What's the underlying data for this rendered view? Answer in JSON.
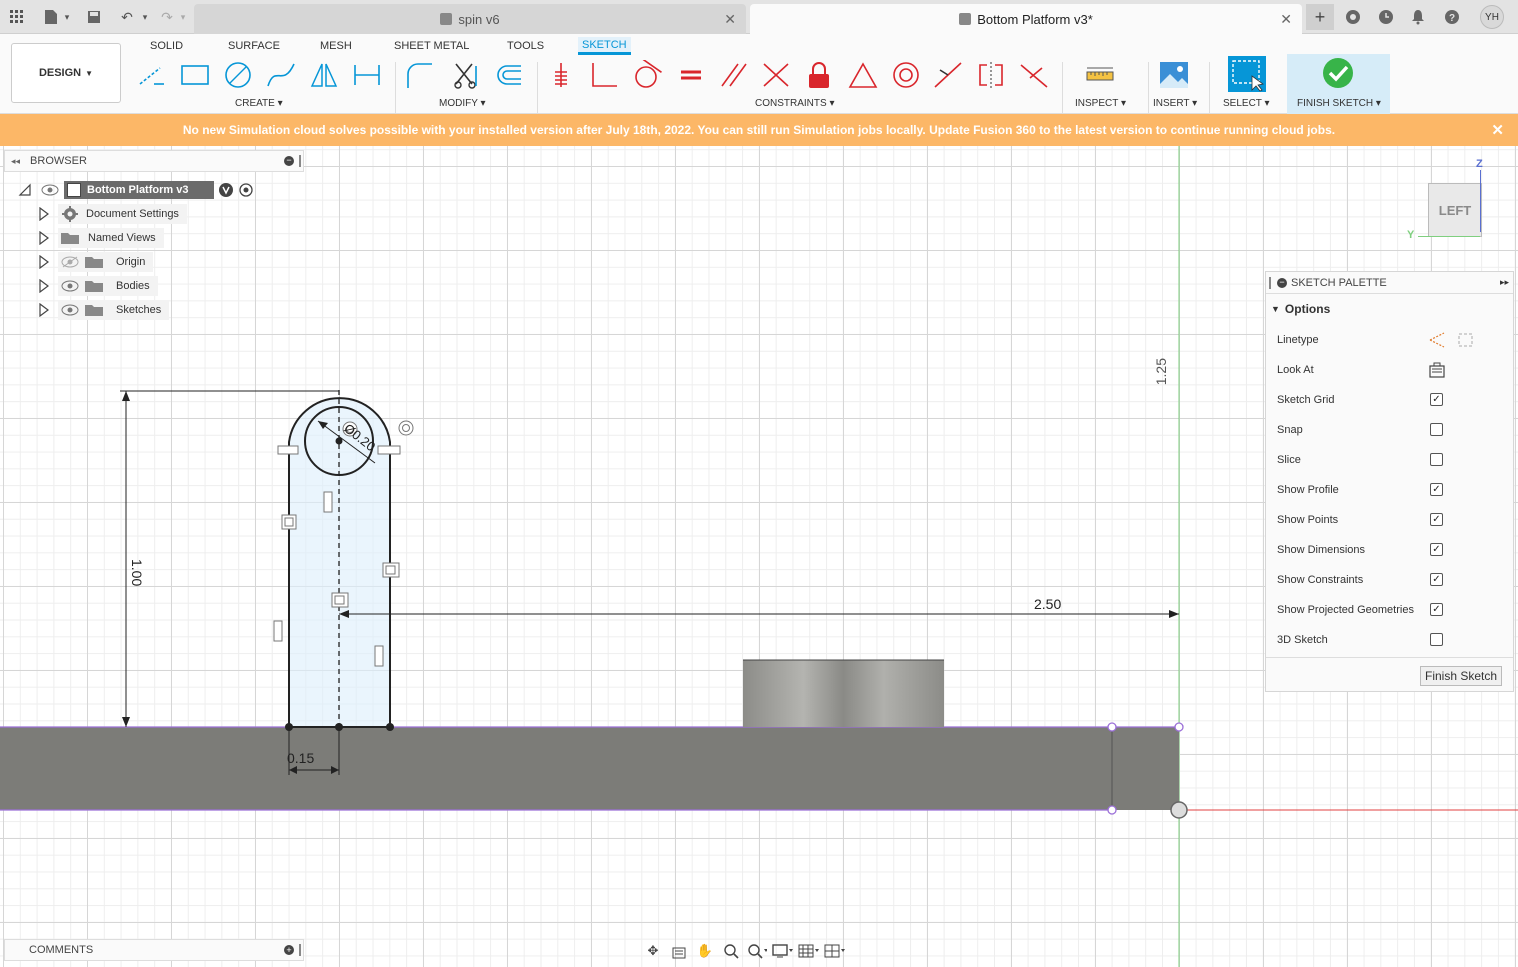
{
  "tabs": {
    "inactive_title": "spin v6",
    "active_title": "Bottom Platform v3*"
  },
  "user": {
    "initials": "YH"
  },
  "toolbar": {
    "workspace": "DESIGN",
    "tabs": [
      "SOLID",
      "SURFACE",
      "MESH",
      "SHEET METAL",
      "TOOLS",
      "SKETCH"
    ],
    "groups": {
      "create": "CREATE",
      "modify": "MODIFY",
      "constraints": "CONSTRAINTS",
      "inspect": "INSPECT",
      "insert": "INSERT",
      "select": "SELECT",
      "finish": "FINISH SKETCH"
    }
  },
  "banner": {
    "text": "No new Simulation cloud solves possible with your installed version after July 18th, 2022. You can still run Simulation jobs locally. Update Fusion 360 to the latest version to continue running cloud jobs."
  },
  "browser": {
    "title": "BROWSER",
    "root": "Bottom Platform v3",
    "items": [
      {
        "label": "Document Settings",
        "icon": "gear-icon"
      },
      {
        "label": "Named Views",
        "icon": "folder-icon"
      },
      {
        "label": "Origin",
        "icon": "folder-icon"
      },
      {
        "label": "Bodies",
        "icon": "folder-icon"
      },
      {
        "label": "Sketches",
        "icon": "folder-icon"
      }
    ]
  },
  "palette": {
    "title": "SKETCH PALETTE",
    "section": "Options",
    "rows": [
      {
        "label": "Linetype",
        "type": "icons"
      },
      {
        "label": "Look At",
        "type": "icon"
      },
      {
        "label": "Sketch Grid",
        "checked": true
      },
      {
        "label": "Snap",
        "checked": false
      },
      {
        "label": "Slice",
        "checked": false
      },
      {
        "label": "Show Profile",
        "checked": true
      },
      {
        "label": "Show Points",
        "checked": true
      },
      {
        "label": "Show Dimensions",
        "checked": true
      },
      {
        "label": "Show Constraints",
        "checked": true
      },
      {
        "label": "Show Projected Geometries",
        "checked": true
      },
      {
        "label": "3D Sketch",
        "checked": false
      }
    ],
    "finish_button": "Finish Sketch"
  },
  "comments": {
    "title": "COMMENTS"
  },
  "viewcube": {
    "face": "LEFT",
    "axis_z": "Z",
    "axis_y": "Y"
  },
  "dimensions": {
    "height": "1.00",
    "width": "0.15",
    "length": "2.50",
    "top": "1.25",
    "hole": "Ø0.20"
  },
  "colors": {
    "accent": "#0696d7",
    "banner": "#fcb767",
    "constraint_red": "#d9262c",
    "body_gray": "#7c7c78",
    "projected_purple": "#9b6fd8"
  }
}
